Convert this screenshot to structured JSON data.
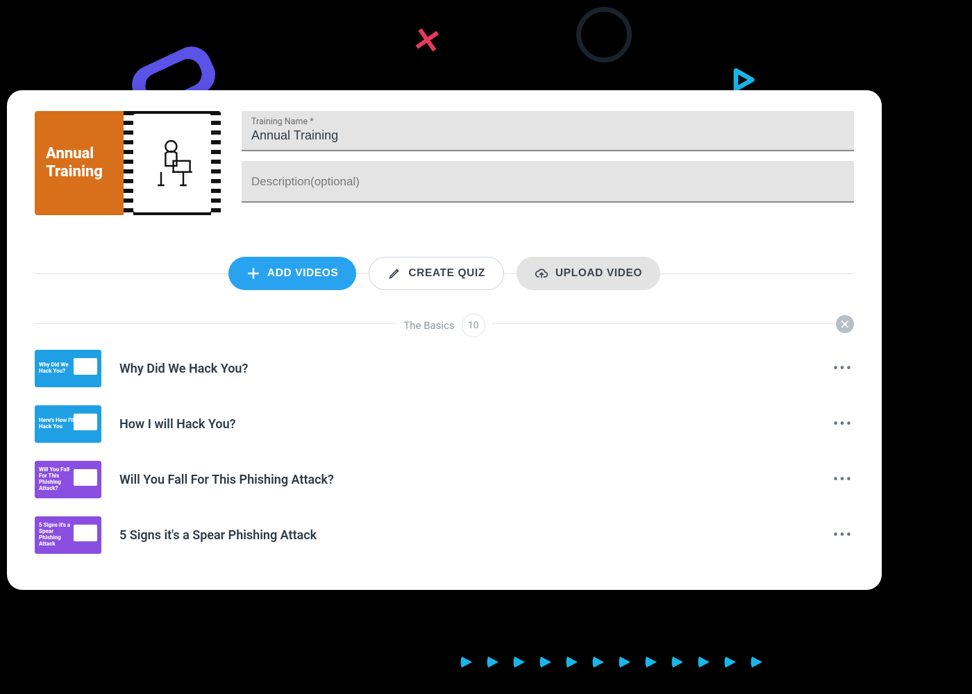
{
  "hero": {
    "title": "Annual Training"
  },
  "fields": {
    "name_label": "Training Name *",
    "name_value": "Annual Training",
    "desc_placeholder": "Description(optional)"
  },
  "actions": {
    "add_videos": "ADD VIDEOS",
    "create_quiz": "CREATE QUIZ",
    "upload_video": "UPLOAD VIDEO"
  },
  "section": {
    "title": "The Basics",
    "count": "10"
  },
  "videos": [
    {
      "title": "Why Did We Hack You?",
      "thumb_text": "Why Did We Hack You?",
      "color": "blue"
    },
    {
      "title": "How I will Hack You?",
      "thumb_text": "Here's How I'll Hack You",
      "color": "blue"
    },
    {
      "title": "Will You Fall For This Phishing Attack?",
      "thumb_text": "Will You Fall For This Phishing Attack?",
      "color": "purple"
    },
    {
      "title": "5 Signs it's a Spear Phishing Attack",
      "thumb_text": "5 Signs it's a Spear Phishing Attack",
      "color": "purple"
    }
  ],
  "colors": {
    "accent_blue": "#29a3ef",
    "accent_dark": "#2e3a46"
  }
}
